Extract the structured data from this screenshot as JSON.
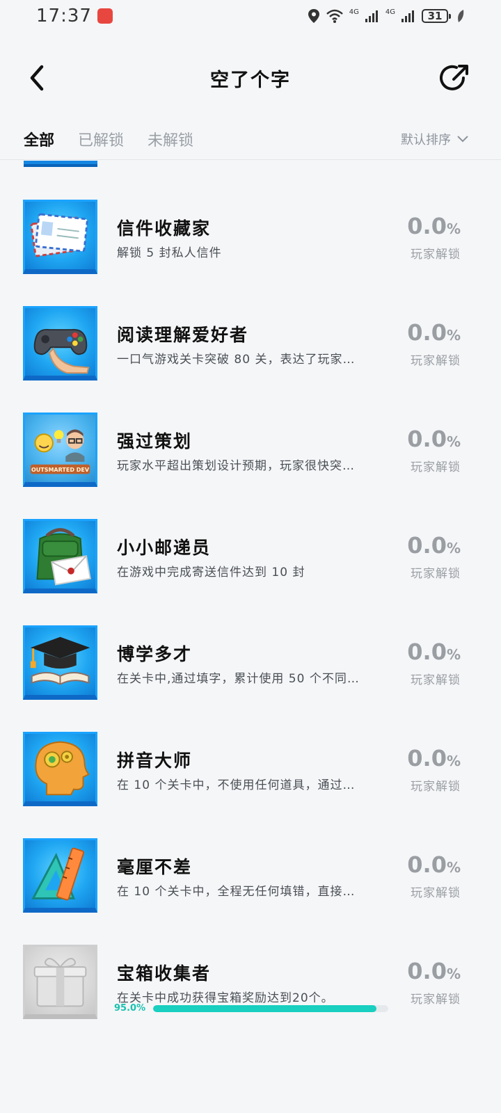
{
  "status_bar": {
    "time": "17:37",
    "network_1": "4G",
    "network_2": "4G",
    "battery": "31",
    "icons": [
      "app-badge-icon",
      "location-icon",
      "wifi-icon",
      "signal-icon",
      "signal-icon",
      "battery-icon",
      "leaf-icon"
    ]
  },
  "header": {
    "title": "空了个字",
    "back_icon": "chevron-left-icon",
    "share_icon": "share-icon"
  },
  "tabs": [
    {
      "label": "全部",
      "active": true
    },
    {
      "label": "已解锁",
      "active": false
    },
    {
      "label": "未解锁",
      "active": false
    }
  ],
  "sort": {
    "label": "默认排序",
    "icon": "chevron-down-icon"
  },
  "rate_label": "玩家解锁",
  "rate_unit": "%",
  "achievements": [
    {
      "title": "信件收藏家",
      "desc": "解锁 5 封私人信件",
      "rate": "0.0",
      "icon": "letters-icon"
    },
    {
      "title": "阅读理解爱好者",
      "desc": "一口气游戏关卡突破 80 关，表达了玩家…",
      "rate": "0.0",
      "icon": "gamepad-icon"
    },
    {
      "title": "强过策划",
      "desc": "玩家水平超出策划设计预期，玩家很快突…",
      "rate": "0.0",
      "icon": "outsmarted-dev-icon",
      "icon_text": "OUTSMARTED DEV"
    },
    {
      "title": "小小邮递员",
      "desc": "在游戏中完成寄送信件达到 10 封",
      "rate": "0.0",
      "icon": "mailbag-icon"
    },
    {
      "title": "博学多才",
      "desc": "在关卡中,通过填字，累计使用 50 个不同…",
      "rate": "0.0",
      "icon": "graduation-cap-icon"
    },
    {
      "title": "拼音大师",
      "desc": "在 10 个关卡中，不使用任何道具，通过…",
      "rate": "0.0",
      "icon": "brain-gears-icon"
    },
    {
      "title": "毫厘不差",
      "desc": "在 10 个关卡中，全程无任何填错，直接…",
      "rate": "0.0",
      "icon": "ruler-icon"
    },
    {
      "title": "宝箱收集者",
      "desc": "在关卡中成功获得宝箱奖励达到20个。",
      "rate": "0.0",
      "icon": "gift-box-icon",
      "locked": true,
      "progress_label": "95.0%",
      "progress": 0.95
    }
  ],
  "colors": {
    "background": "#f5f6f8",
    "icon_blue": "#1fa6f2",
    "progress": "#18cfc0",
    "muted": "#9a9ea3"
  }
}
